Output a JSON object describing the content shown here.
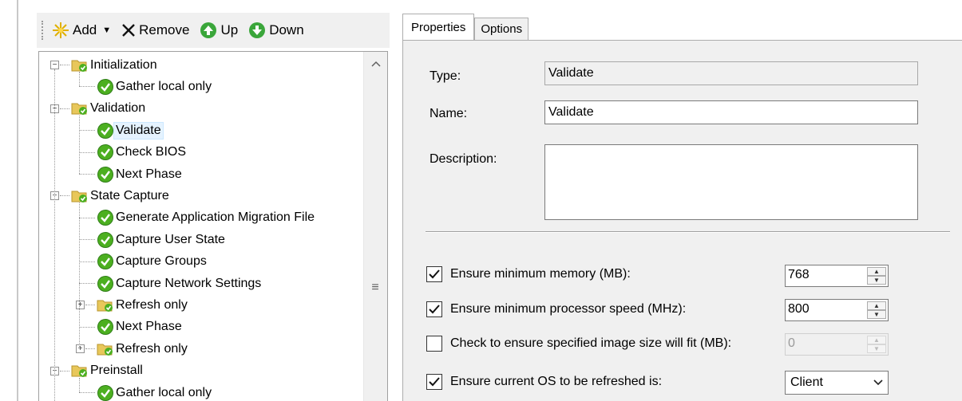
{
  "toolbar": {
    "add_label": "Add",
    "remove_label": "Remove",
    "up_label": "Up",
    "down_label": "Down"
  },
  "tree": {
    "items": [
      {
        "label": "Initialization",
        "kind": "group",
        "expanded": true
      },
      {
        "label": "Gather local only",
        "kind": "step"
      },
      {
        "label": "Validation",
        "kind": "group",
        "expanded": true
      },
      {
        "label": "Validate",
        "kind": "step",
        "selected": true
      },
      {
        "label": "Check BIOS",
        "kind": "step"
      },
      {
        "label": "Next Phase",
        "kind": "step"
      },
      {
        "label": "State Capture",
        "kind": "group",
        "expanded": true
      },
      {
        "label": "Generate Application Migration File",
        "kind": "step"
      },
      {
        "label": "Capture User State",
        "kind": "step"
      },
      {
        "label": "Capture Groups",
        "kind": "step"
      },
      {
        "label": "Capture Network Settings",
        "kind": "step"
      },
      {
        "label": "Refresh only",
        "kind": "group",
        "expanded": false
      },
      {
        "label": "Next Phase",
        "kind": "step"
      },
      {
        "label": "Refresh only",
        "kind": "group",
        "expanded": false
      },
      {
        "label": "Preinstall",
        "kind": "group",
        "expanded": true
      },
      {
        "label": "Gather local only",
        "kind": "step"
      }
    ]
  },
  "tabs": {
    "properties": "Properties",
    "options": "Options",
    "active": "Properties"
  },
  "form": {
    "type_label": "Type:",
    "type_value": "Validate",
    "name_label": "Name:",
    "name_value": "Validate",
    "description_label": "Description:",
    "description_value": ""
  },
  "checks": {
    "min_memory": {
      "label": "Ensure minimum memory (MB):",
      "checked": true,
      "value": "768"
    },
    "min_cpu": {
      "label": "Ensure minimum processor speed (MHz):",
      "checked": true,
      "value": "800"
    },
    "image_size": {
      "label": "Check to ensure specified image size will fit (MB):",
      "checked": false,
      "value": "0"
    },
    "os_refresh": {
      "label": "Ensure current OS to be refreshed is:",
      "checked": true,
      "value": "Client"
    }
  },
  "colors": {
    "step_icon": "#4caf20",
    "folder_icon": "#e8c75a",
    "nav_icon": "#3aa63a",
    "add_icon": "#e0b000"
  }
}
